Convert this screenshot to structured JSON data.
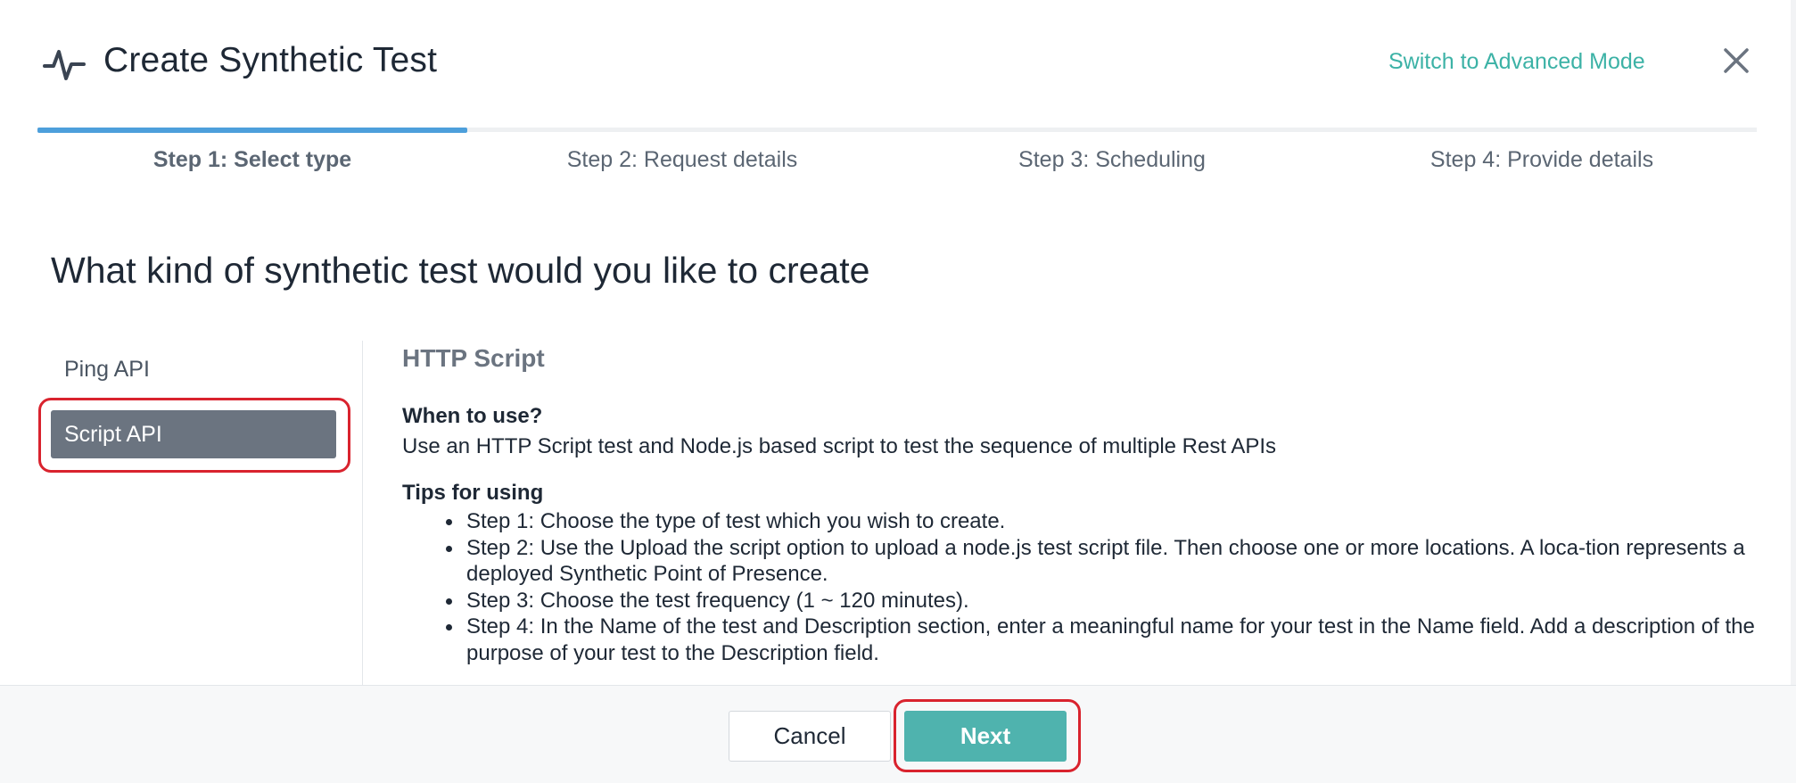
{
  "header": {
    "title": "Create Synthetic Test",
    "icon": "pulse-icon",
    "switch_mode_label": "Switch to Advanced Mode",
    "close_icon": "close-icon"
  },
  "progress": {
    "current_step": 1,
    "total_steps": 4
  },
  "steps": [
    {
      "label": "Step 1: Select type",
      "active": true
    },
    {
      "label": "Step 2: Request details",
      "active": false
    },
    {
      "label": "Step 3: Scheduling",
      "active": false
    },
    {
      "label": "Step 4: Provide details",
      "active": false
    }
  ],
  "question": "What kind of synthetic test would you like to create",
  "types": [
    {
      "label": "Ping API",
      "selected": false
    },
    {
      "label": "Script API",
      "selected": true
    }
  ],
  "description": {
    "title": "HTTP Script",
    "when_label": "When to use?",
    "when_text": "Use an HTTP Script test and Node.js based script to test the sequence of multiple Rest APIs",
    "tips_label": "Tips for using",
    "tips": [
      "Step 1: Choose the type of test which you wish to create.",
      "Step 2: Use the Upload the script option to upload a node.js test script file. Then choose one or more locations. A loca-tion represents a deployed Synthetic Point of Presence.",
      "Step 3: Choose the test frequency (1 ~ 120 minutes).",
      "Step 4: In the Name of the test and Description section, enter a meaningful name for your test in the Name field. Add a description of the purpose of your test to the Description field."
    ]
  },
  "footer": {
    "cancel_label": "Cancel",
    "next_label": "Next"
  },
  "colors": {
    "accent": "#3cb2a6",
    "progress": "#4d9fdb",
    "selected_item": "#6b7480",
    "primary_button": "#4fb3ae",
    "highlight": "#d9232e"
  }
}
